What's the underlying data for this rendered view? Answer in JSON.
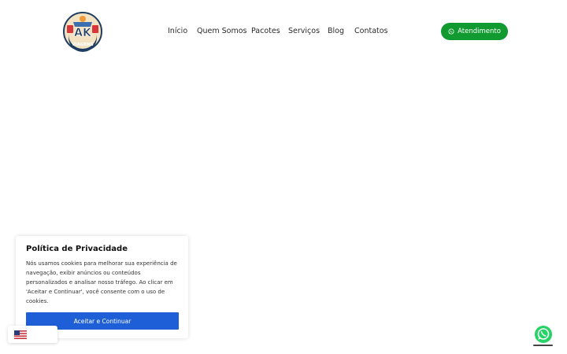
{
  "brand": {
    "logo_text": "AK",
    "logo_subtext": "VIAGENS"
  },
  "nav": {
    "items": [
      {
        "label": "Início"
      },
      {
        "label": "Quem Somos"
      },
      {
        "label": "Pacotes"
      },
      {
        "label": "Serviços"
      },
      {
        "label": "Blog"
      },
      {
        "label": "Contatos"
      }
    ],
    "cta_label": "Atendimento",
    "cta_icon": "whatsapp-icon"
  },
  "cookie_banner": {
    "title": "Política de Privacidade",
    "text": "Nós usamos cookies para melhorar sua experiência de navegação, exibir anúncios ou conteúdos personalizados e analisar nosso tráfego. Ao clicar em 'Aceitar e Continuar', você consente com o uso de cookies.",
    "accept_label": "Aceitar e Continuar"
  },
  "language_switcher": {
    "flag_icon": "us-flag-icon"
  },
  "floating_chat": {
    "icon": "whatsapp-icon"
  },
  "colors": {
    "cta_green": "#119a2f",
    "accept_blue": "#1e5fd8",
    "whatsapp_green": "#25d366"
  }
}
